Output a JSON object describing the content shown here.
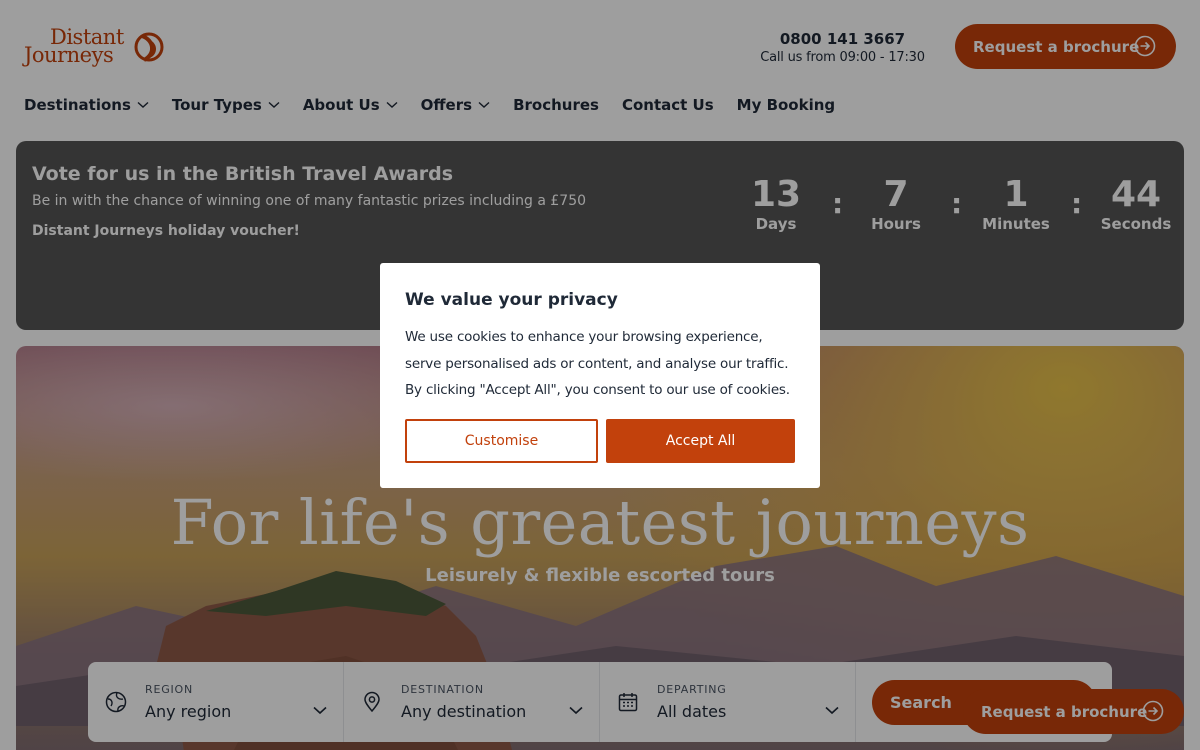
{
  "brand": {
    "logo_line1": "Distant",
    "logo_line2": "Journeys",
    "color": "#c2410c"
  },
  "header": {
    "phone": "0800 141 3667",
    "hours": "Call us from 09:00 - 17:30",
    "brochure_label": "Request a brochure"
  },
  "nav": {
    "items": [
      {
        "label": "Destinations",
        "dropdown": true
      },
      {
        "label": "Tour Types",
        "dropdown": true
      },
      {
        "label": "About Us",
        "dropdown": true
      },
      {
        "label": "Offers",
        "dropdown": true
      },
      {
        "label": "Brochures",
        "dropdown": false
      },
      {
        "label": "Contact Us",
        "dropdown": false
      },
      {
        "label": "My Booking",
        "dropdown": false
      }
    ]
  },
  "banner": {
    "title": "Vote for us in the British Travel Awards",
    "subtitle": "Be in with the chance of winning one of many fantastic prizes including a £750",
    "subtitle2": "Distant Journeys holiday voucher!",
    "countdown": {
      "days": "13",
      "days_label": "Days",
      "hours": "7",
      "hours_label": "Hours",
      "minutes": "1",
      "minutes_label": "Minutes",
      "seconds": "44",
      "seconds_label": "Seconds",
      "separator": ":"
    }
  },
  "hero": {
    "title": "For life's greatest journeys",
    "subtitle": "Leisurely & flexible escorted tours"
  },
  "search": {
    "region_label": "REGION",
    "region_value": "Any region",
    "destination_label": "DESTINATION",
    "destination_value": "Any destination",
    "departing_label": "DEPARTING",
    "departing_value": "All dates",
    "button_label": "Search"
  },
  "floating": {
    "brochure_label": "Request a brochure"
  },
  "cookie_modal": {
    "title": "We value your privacy",
    "text": "We use cookies to enhance your browsing experience, serve personalised ads or content, and analyse our traffic. By clicking \"Accept All\", you consent to our use of cookies.",
    "customise_label": "Customise",
    "accept_label": "Accept All"
  }
}
